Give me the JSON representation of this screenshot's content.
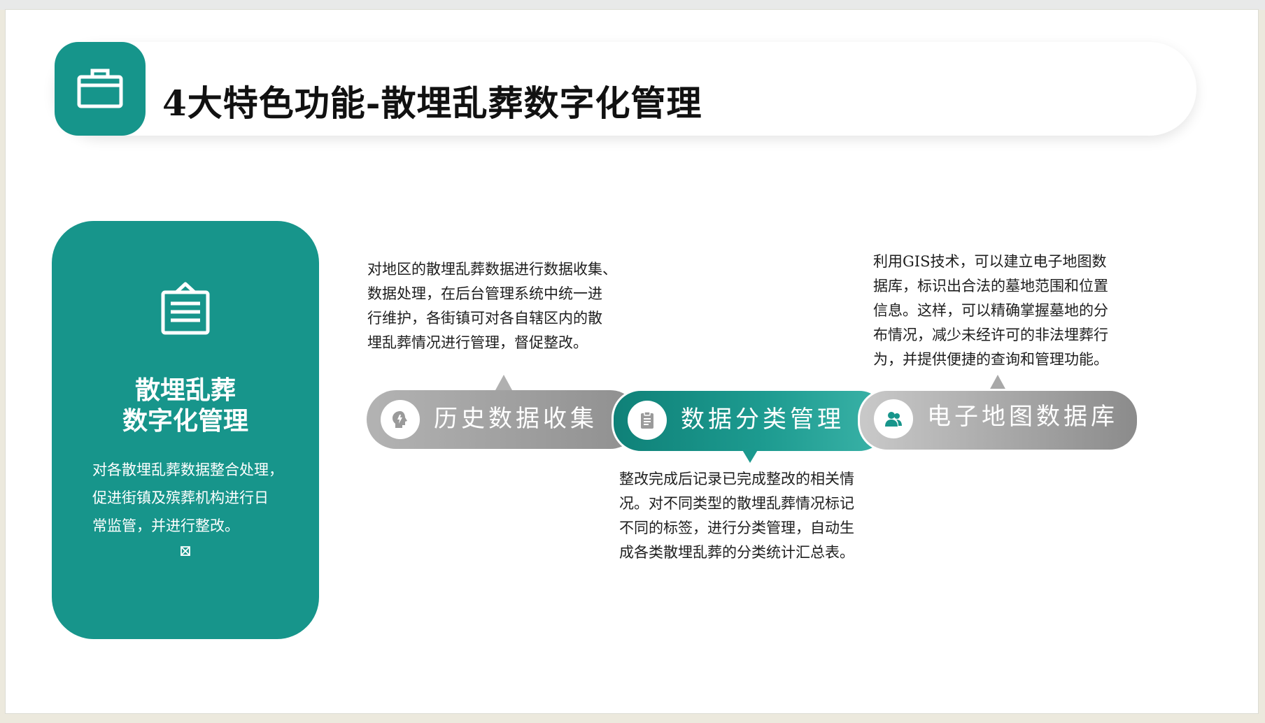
{
  "header": {
    "title": "4大特色功能-散埋乱葬数字化管理",
    "icon": "briefcase-icon"
  },
  "left_card": {
    "icon": "document-icon",
    "title_line1": "散埋乱葬",
    "title_line2": "数字化管理",
    "desc_line1": "对各散埋乱葬数据整合处理，",
    "desc_line2": "促进街镇及殡葬机构进行日",
    "desc_line3": "常监管，并进行整改。",
    "glyph": "⊠"
  },
  "features": [
    {
      "label": "历史数据收集",
      "icon": "lightbulb-head-icon",
      "lines": [
        "对地区的散埋乱葬数据进行数据收集、",
        "数据处理，在后台管理系统中统一进",
        "行维护，各街镇可对各自辖区内的散",
        "埋乱葬情况进行管理，督促整改。"
      ]
    },
    {
      "label": "数据分类管理",
      "icon": "clipboard-icon",
      "lines": [
        "整改完成后记录已完成整改的相关情",
        "况。对不同类型的散埋乱葬情况标记",
        "不同的标签，进行分类管理，自动生",
        "成各类散埋乱葬的分类统计汇总表。"
      ]
    },
    {
      "label": "电子地图数据库",
      "icon": "users-icon",
      "lines": [
        "利用GIS技术，可以建立电子地图数",
        "据库，标识出合法的墓地范围和位置",
        "信息。这样，可以精确掌握墓地的分",
        "布情况，减少未经许可的非法埋葬行",
        "为，并提供便捷的查询和管理功能。"
      ]
    }
  ],
  "colors": {
    "teal": "#17958b",
    "gray": "#9a9a9a"
  }
}
